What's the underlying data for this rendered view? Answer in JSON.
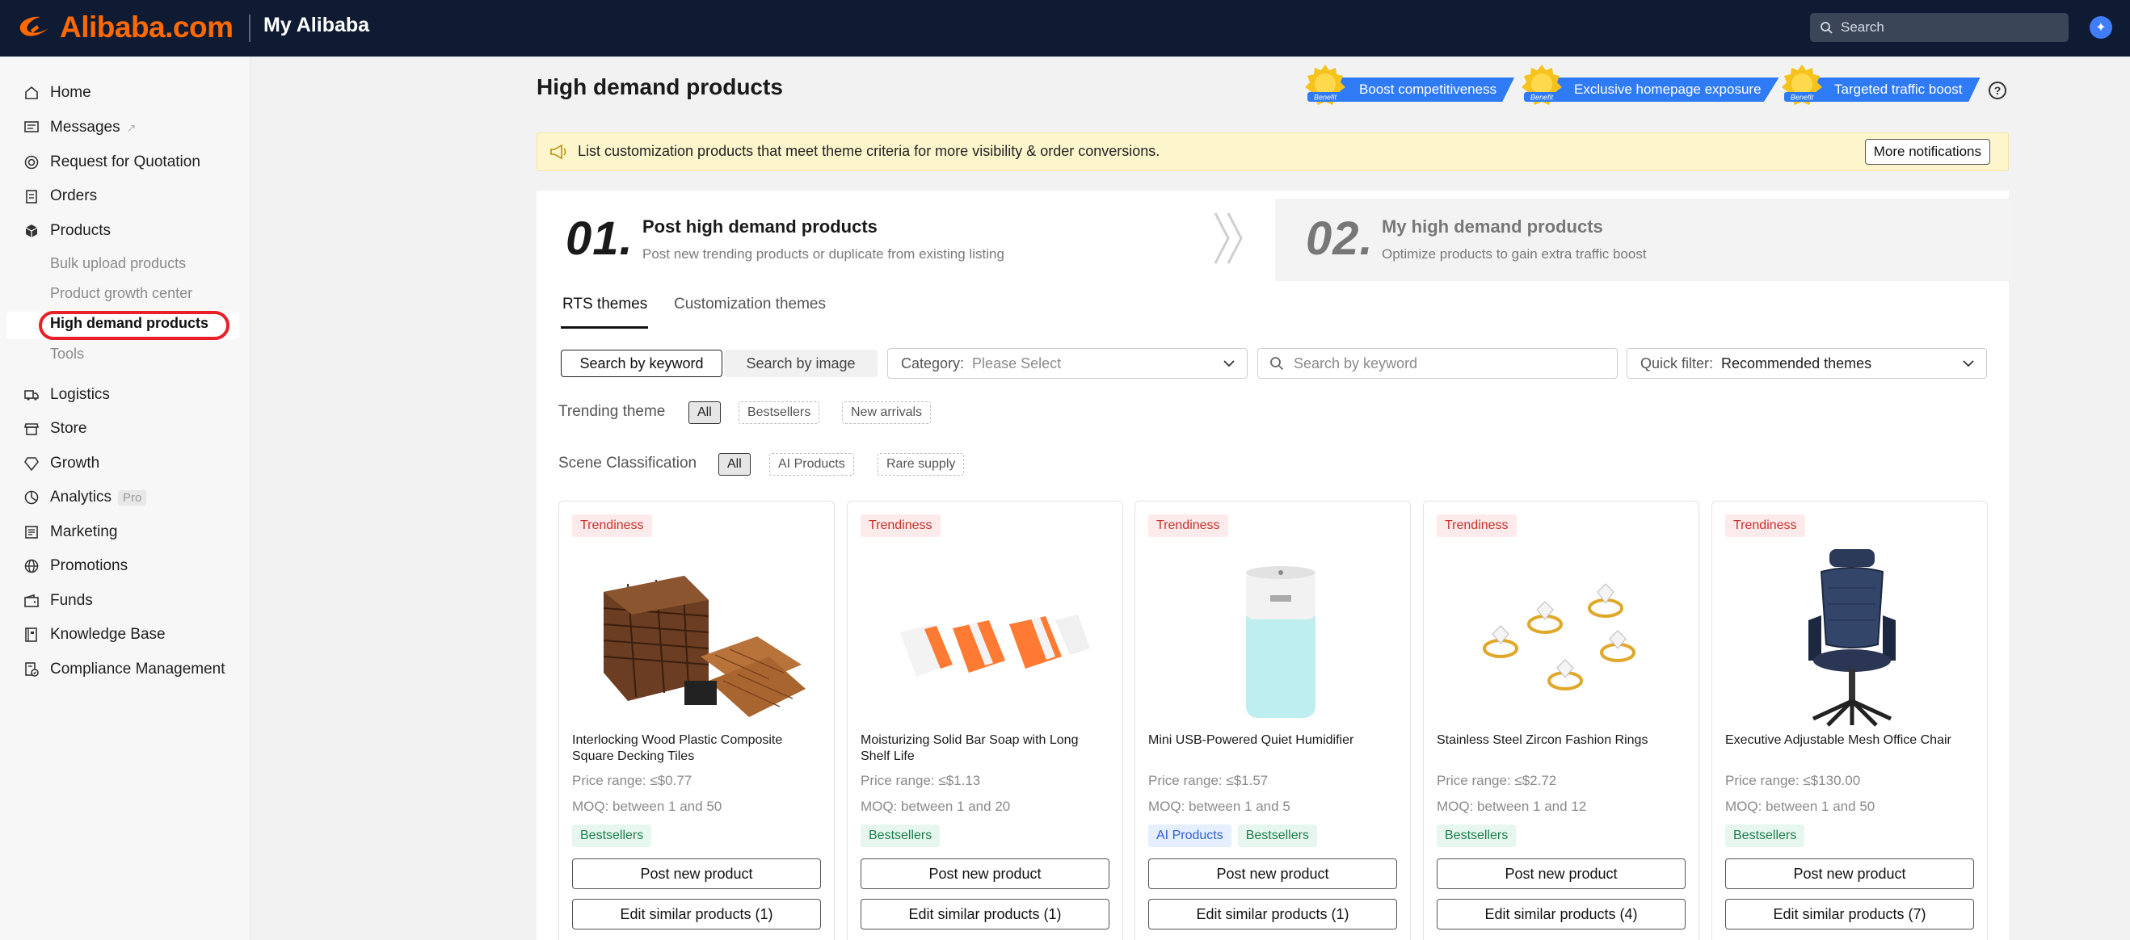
{
  "header": {
    "logo_text": "Alibaba.com",
    "title": "My Alibaba",
    "search_placeholder": "Search"
  },
  "sidebar": {
    "items": [
      {
        "label": "Home",
        "icon": "home-icon"
      },
      {
        "label": "Messages",
        "icon": "message-icon"
      },
      {
        "label": "Request for Quotation",
        "icon": "target-icon"
      },
      {
        "label": "Orders",
        "icon": "clipboard-icon"
      },
      {
        "label": "Products",
        "icon": "box-icon"
      },
      {
        "label": "Logistics",
        "icon": "truck-icon"
      },
      {
        "label": "Store",
        "icon": "store-icon"
      },
      {
        "label": "Growth",
        "icon": "diamond-icon"
      },
      {
        "label": "Analytics",
        "icon": "chart-icon",
        "badge": "Pro"
      },
      {
        "label": "Marketing",
        "icon": "megaphone-icon"
      },
      {
        "label": "Promotions",
        "icon": "globe-icon"
      },
      {
        "label": "Funds",
        "icon": "wallet-icon"
      },
      {
        "label": "Knowledge Base",
        "icon": "book-icon"
      },
      {
        "label": "Compliance Management",
        "icon": "shield-doc-icon"
      }
    ],
    "products_sub": [
      "Bulk upload products",
      "Product growth center",
      "High demand products",
      "Tools"
    ]
  },
  "main": {
    "title": "High demand products",
    "benefits": [
      {
        "badge": "Benefit",
        "label": "Boost competitiveness"
      },
      {
        "badge": "Benefit",
        "label": "Exclusive homepage exposure"
      },
      {
        "badge": "Benefit",
        "label": "Targeted traffic boost"
      }
    ],
    "notice": {
      "text": "List customization products that meet theme criteria for more visibility & order conversions.",
      "button": "More notifications"
    },
    "steps": [
      {
        "num": "01.",
        "title": "Post high demand products",
        "desc": "Post new trending products or duplicate from existing listing"
      },
      {
        "num": "02.",
        "title": "My high demand products",
        "desc": "Optimize products to gain extra traffic boost"
      }
    ],
    "tabs": [
      "RTS themes",
      "Customization themes"
    ],
    "search_modes": [
      "Search by keyword",
      "Search by image"
    ],
    "category": {
      "label": "Category:",
      "placeholder": "Please Select"
    },
    "keyword_placeholder": "Search by keyword",
    "quick_filter": {
      "label": "Quick filter:",
      "value": "Recommended themes"
    },
    "trending": {
      "label": "Trending theme",
      "chips": [
        "All",
        "Bestsellers",
        "New arrivals"
      ]
    },
    "scene": {
      "label": "Scene Classification",
      "chips": [
        "All",
        "AI Products",
        "Rare supply"
      ]
    },
    "products": [
      {
        "badge": "Trendiness",
        "name": "Interlocking Wood Plastic Composite Square Decking Tiles",
        "price": "Price range: ≤$0.77",
        "moq": "MOQ: between 1 and 50",
        "tags": [
          "Bestsellers"
        ],
        "post": "Post new product",
        "edit": "Edit similar products (1)"
      },
      {
        "badge": "Trendiness",
        "name": "Moisturizing Solid Bar Soap with Long Shelf Life",
        "price": "Price range: ≤$1.13",
        "moq": "MOQ: between 1 and 20",
        "tags": [
          "Bestsellers"
        ],
        "post": "Post new product",
        "edit": "Edit similar products (1)"
      },
      {
        "badge": "Trendiness",
        "name": "Mini USB-Powered Quiet Humidifier",
        "price": "Price range: ≤$1.57",
        "moq": "MOQ: between 1 and 5",
        "tags": [
          "AI Products",
          "Bestsellers"
        ],
        "post": "Post new product",
        "edit": "Edit similar products (1)"
      },
      {
        "badge": "Trendiness",
        "name": "Stainless Steel Zircon Fashion Rings",
        "price": "Price range: ≤$2.72",
        "moq": "MOQ: between 1 and 12",
        "tags": [
          "Bestsellers"
        ],
        "post": "Post new product",
        "edit": "Edit similar products (4)"
      },
      {
        "badge": "Trendiness",
        "name": "Executive Adjustable Mesh Office Chair",
        "price": "Price range: ≤$130.00",
        "moq": "MOQ: between 1 and 50",
        "tags": [
          "Bestsellers"
        ],
        "post": "Post new product",
        "edit": "Edit similar products (7)"
      }
    ]
  }
}
